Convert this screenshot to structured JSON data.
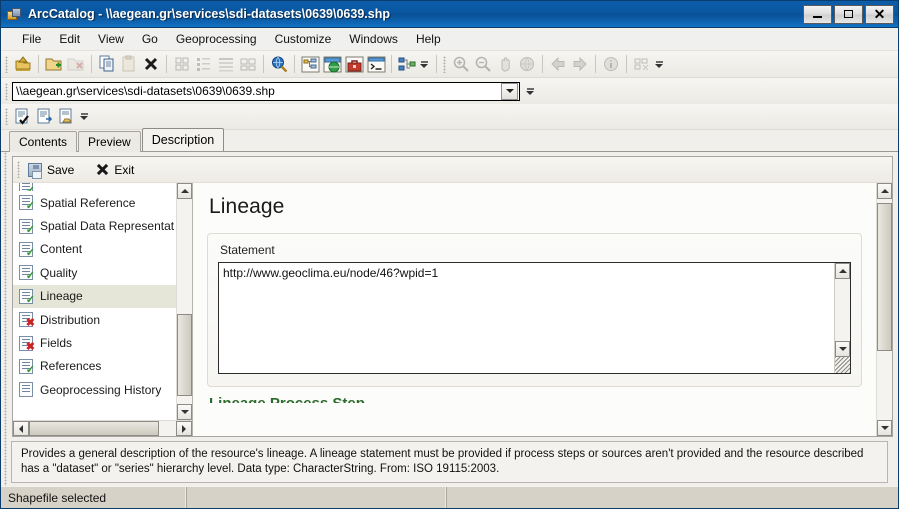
{
  "window": {
    "title": "ArcCatalog - \\\\aegean.gr\\services\\sdi-datasets\\0639\\0639.shp",
    "icon": "arccatalog-icon",
    "buttons": {
      "minimize": "_",
      "maximize": "□",
      "close": "✕"
    }
  },
  "menu": {
    "items": [
      {
        "label": "File"
      },
      {
        "label": "Edit"
      },
      {
        "label": "View"
      },
      {
        "label": "Go"
      },
      {
        "label": "Geoprocessing"
      },
      {
        "label": "Customize"
      },
      {
        "label": "Windows"
      },
      {
        "label": "Help"
      }
    ]
  },
  "toolbar": {
    "standard": [
      {
        "name": "up-one-level-icon",
        "enabled": true
      },
      {
        "name": "connect-to-folder-icon",
        "enabled": true
      },
      {
        "name": "disconnect-folder-icon",
        "enabled": false
      },
      {
        "name": "copy-icon",
        "enabled": true
      },
      {
        "name": "paste-icon",
        "enabled": false
      },
      {
        "name": "delete-icon",
        "enabled": true
      },
      {
        "name": "large-icons-view-icon",
        "enabled": false
      },
      {
        "name": "list-view-icon",
        "enabled": false
      },
      {
        "name": "details-view-icon",
        "enabled": false
      },
      {
        "name": "thumbnails-view-icon",
        "enabled": false
      },
      {
        "name": "search-icon",
        "enabled": true
      },
      {
        "name": "catalog-tree-icon",
        "enabled": true
      },
      {
        "name": "arcmap-icon",
        "enabled": true
      },
      {
        "name": "toolbox-icon",
        "enabled": true
      },
      {
        "name": "python-window-icon",
        "enabled": true
      },
      {
        "name": "model-builder-icon",
        "enabled": true
      }
    ],
    "geography": [
      {
        "name": "zoom-in-icon",
        "enabled": false
      },
      {
        "name": "zoom-out-icon",
        "enabled": false
      },
      {
        "name": "pan-icon",
        "enabled": false
      },
      {
        "name": "full-extent-icon",
        "enabled": false
      },
      {
        "name": "back-arrow-icon",
        "enabled": false
      },
      {
        "name": "forward-arrow-icon",
        "enabled": false
      },
      {
        "name": "identify-icon",
        "enabled": false
      },
      {
        "name": "create-thumbnail-icon",
        "enabled": false
      }
    ],
    "metadata": [
      {
        "name": "validate-metadata-icon",
        "enabled": true
      },
      {
        "name": "export-metadata-icon",
        "enabled": true
      },
      {
        "name": "import-metadata-icon",
        "enabled": true
      }
    ],
    "overflow_label": "toolbar-options"
  },
  "address": {
    "value": "\\\\aegean.gr\\services\\sdi-datasets\\0639\\0639.shp",
    "placeholder": "",
    "dropdown_icon": "chevron-down-icon"
  },
  "tabs": [
    {
      "label": "Contents",
      "active": false
    },
    {
      "label": "Preview",
      "active": false
    },
    {
      "label": "Description",
      "active": true
    }
  ],
  "editor": {
    "toolbar": {
      "save_label": "Save",
      "save_icon": "floppy-disk-icon",
      "exit_label": "Exit",
      "exit_icon": "close-x-icon"
    },
    "tree": {
      "items": [
        {
          "label": "Spatial Reference",
          "status": "ok",
          "selected": false
        },
        {
          "label": "Spatial Data Representat",
          "status": "ok",
          "selected": false
        },
        {
          "label": "Content",
          "status": "ok",
          "selected": false
        },
        {
          "label": "Quality",
          "status": "ok",
          "selected": false
        },
        {
          "label": "Lineage",
          "status": "ok",
          "selected": true
        },
        {
          "label": "Distribution",
          "status": "bad",
          "selected": false
        },
        {
          "label": "Fields",
          "status": "bad",
          "selected": false
        },
        {
          "label": "References",
          "status": "ok",
          "selected": false
        },
        {
          "label": "Geoprocessing History",
          "status": "plain",
          "selected": false
        }
      ],
      "badge_ok": "✓",
      "badge_bad": "✖"
    },
    "content": {
      "heading": "Lineage",
      "statement_label": "Statement",
      "statement_value": "http://www.geoclima.eu/node/46?wpid=1",
      "statement_placeholder": "",
      "next_section_peek": "Lineage Process Step"
    }
  },
  "help": {
    "text": "Provides a general description of the resource's lineage. A lineage statement must be provided if process steps or sources aren't provided and the resource described has a \"dataset\" or \"series\" hierarchy level. Data type: CharacterString. From: ISO 19115:2003."
  },
  "status": {
    "message": "Shapefile selected",
    "cell2": "",
    "cell3": ""
  },
  "colors": {
    "title_bar": "#0a56a0",
    "selection": "#e6e6d8",
    "status_ok": "#2a9a2a",
    "status_bad": "#cc2222",
    "chrome": "#d4d0c8"
  }
}
